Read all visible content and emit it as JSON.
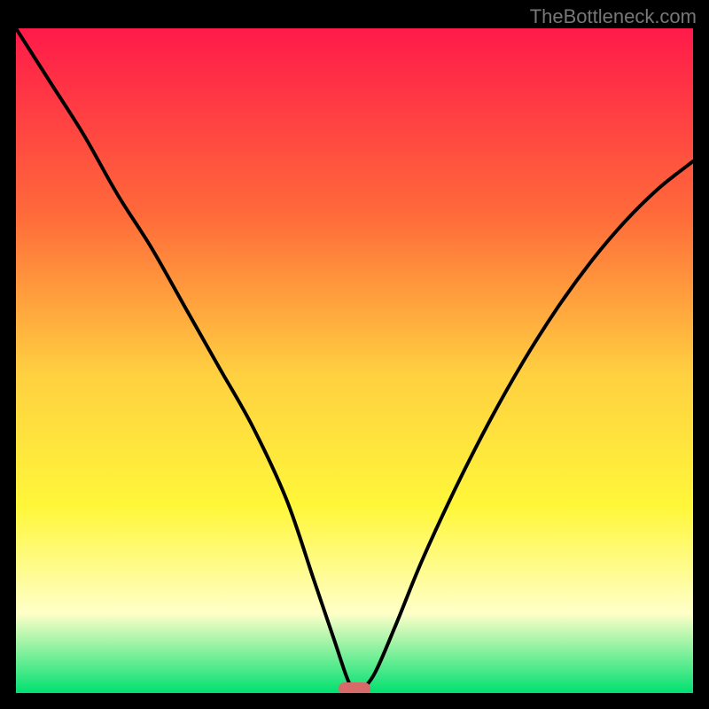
{
  "watermark": "TheBottleneck.com",
  "colors": {
    "frame": "#000000",
    "grad_top": "#ff1a4a",
    "grad_mid1": "#ff6a3a",
    "grad_mid2": "#ffd040",
    "grad_mid3": "#fff73a",
    "grad_light": "#ffffc8",
    "grad_bottom": "#00e070",
    "curve": "#000000",
    "marker": "#d86a6a"
  },
  "chart_data": {
    "type": "line",
    "title": "",
    "xlabel": "",
    "ylabel": "",
    "xlim": [
      0,
      100
    ],
    "ylim": [
      0,
      100
    ],
    "marker_x": 50,
    "series": [
      {
        "name": "curve",
        "x": [
          0,
          5,
          10,
          15,
          20,
          25,
          30,
          35,
          40,
          44,
          47,
          49,
          50,
          51,
          53,
          56,
          60,
          65,
          70,
          75,
          80,
          85,
          90,
          95,
          100
        ],
        "y": [
          100,
          92,
          84,
          75,
          67,
          58,
          49,
          40,
          29,
          17,
          8,
          2,
          0.5,
          0.5,
          3,
          10,
          20,
          31,
          41,
          50,
          58,
          65,
          71,
          76,
          80
        ]
      }
    ],
    "annotations": []
  }
}
